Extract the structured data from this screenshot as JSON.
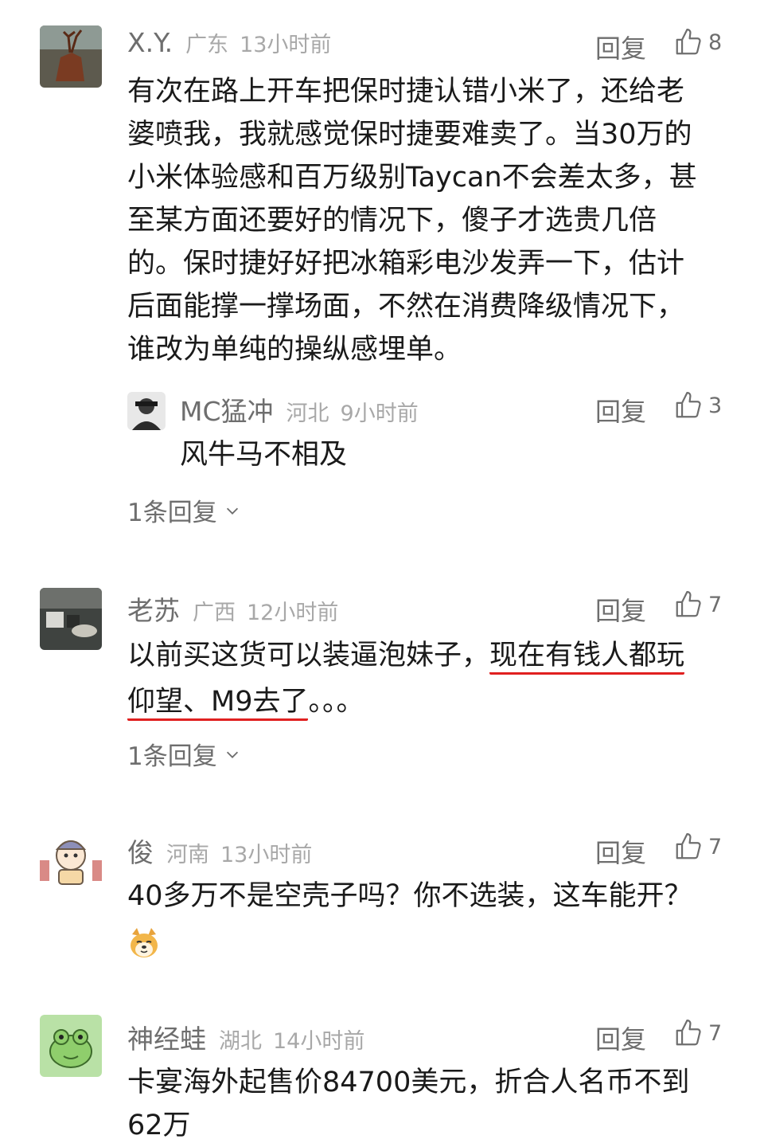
{
  "comments": [
    {
      "name": "X.Y.",
      "location": "广东",
      "time": "13小时前",
      "reply_label": "回复",
      "likes": "8",
      "text_lines": [
        "有次在路上开车把保时捷认错小米了，还给老",
        "婆喷我，我就感觉保时捷要难卖了。当30万的",
        "小米体验感和百万级别Taycan不会差太多，甚",
        "至某方面还要好的情况下，傻子才选贵几倍",
        "的。保时捷好好把冰箱彩电沙发弄一下，估计",
        "后面能撑一撑场面，不然在消费降级情况下，",
        "谁改为单纯的操纵感埋单。"
      ],
      "sub_reply": {
        "name": "MC猛冲",
        "location": "河北",
        "time": "9小时前",
        "reply_label": "回复",
        "likes": "3",
        "text": "风牛马不相及"
      },
      "more_replies": "1条回复"
    },
    {
      "name": "老苏",
      "location": "广西",
      "time": "12小时前",
      "reply_label": "回复",
      "likes": "7",
      "text_parts": {
        "line1_plain": "以前买这货可以装逼泡妹子，",
        "line1_marked": "现在有钱人都玩",
        "line2_marked": "仰望、M9去了",
        "line2_plain": "。。。"
      },
      "more_replies": "1条回复"
    },
    {
      "name": "俊",
      "location": "河南",
      "time": "13小时前",
      "reply_label": "回复",
      "likes": "7",
      "text": "40多万不是空壳子吗？你不选装，这车能开？"
    },
    {
      "name": "神经蛙",
      "location": "湖北",
      "time": "14小时前",
      "reply_label": "回复",
      "likes": "7",
      "text_lines": [
        "卡宴海外起售价84700美元，折合人名币不到",
        "62万"
      ]
    }
  ],
  "colors": {
    "underline": "#e02020",
    "meta": "#a8a8a8",
    "name": "#6e6e6e"
  },
  "icons": [
    "thumbs-up-icon",
    "chevron-down-icon",
    "doge-emoji-icon"
  ]
}
